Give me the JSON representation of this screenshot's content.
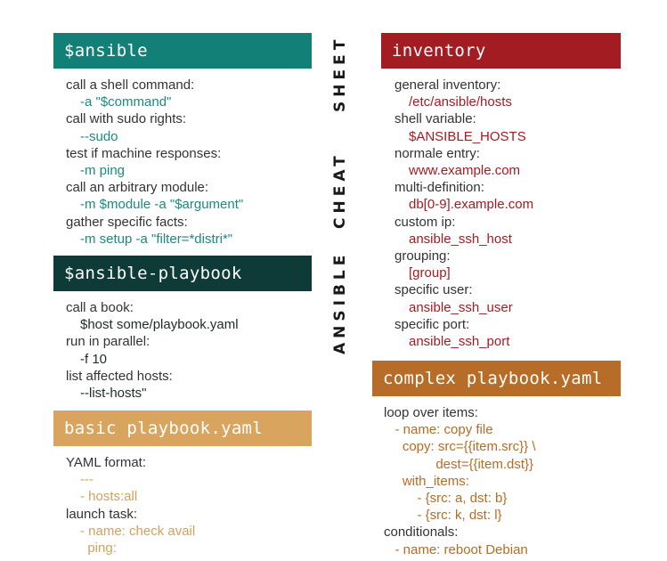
{
  "side_title": {
    "words": [
      "SHEET",
      "CHEAT",
      "ANSIBLE"
    ],
    "full": "ANSIBLE CHEAT SHEET"
  },
  "colors": {
    "ansible_header": "#138077",
    "playbook_header": "#0e3b38",
    "basic_header": "#d9a45e",
    "inventory_header": "#a31c22",
    "complex_header": "#b76c27",
    "teal_text": "#1b8a80",
    "red_text": "#a31c22",
    "tan_text": "#d2a15e",
    "orange_text": "#b56c26"
  },
  "sections": {
    "ansible": {
      "title": "$ansible",
      "items": [
        {
          "label": "call a shell command:",
          "value": "-a \"$command\""
        },
        {
          "label": "call with sudo rights:",
          "value": "--sudo"
        },
        {
          "label": "test if machine responses:",
          "value": "-m ping"
        },
        {
          "label": "call an arbitrary module:",
          "value": "-m $module -a \"$argument\""
        },
        {
          "label": "gather specific facts:",
          "value": "-m setup -a \"filter=*distri*\""
        }
      ]
    },
    "playbook": {
      "title": "$ansible-playbook",
      "items": [
        {
          "label": "call a book:",
          "value": "$host some/playbook.yaml"
        },
        {
          "label": "run in parallel:",
          "value": "-f 10"
        },
        {
          "label": "list affected hosts:",
          "value": "--list-hosts\""
        }
      ]
    },
    "basic": {
      "title": "basic playbook.yaml",
      "lines": [
        {
          "kind": "label",
          "text": "YAML format:"
        },
        {
          "kind": "value",
          "text": "---"
        },
        {
          "kind": "value",
          "text": "- hosts:all"
        },
        {
          "kind": "label",
          "text": "launch task:"
        },
        {
          "kind": "value",
          "text": "- name: check avail"
        },
        {
          "kind": "value",
          "text": "  ping:"
        }
      ]
    },
    "inventory": {
      "title": "inventory",
      "items": [
        {
          "label": "general inventory:",
          "value": "/etc/ansible/hosts"
        },
        {
          "label": "shell variable:",
          "value": "$ANSIBLE_HOSTS"
        },
        {
          "label": "normale entry:",
          "value": "www.example.com"
        },
        {
          "label": "multi-definition:",
          "value": "db[0-9].example.com"
        },
        {
          "label": "custom ip:",
          "value": "ansible_ssh_host"
        },
        {
          "label": "grouping:",
          "value": "[group]"
        },
        {
          "label": "specific user:",
          "value": "ansible_ssh_user"
        },
        {
          "label": "specific port:",
          "value": "ansible_ssh_port"
        }
      ]
    },
    "complex": {
      "title": "complex playbook.yaml",
      "lines": [
        {
          "kind": "label",
          "text": "loop over items:"
        },
        {
          "kind": "value",
          "text": "   - name: copy file"
        },
        {
          "kind": "value",
          "text": "     copy: src={{item.src}} \\"
        },
        {
          "kind": "value",
          "text": "              dest={{item.dst}}"
        },
        {
          "kind": "value",
          "text": "     with_items:"
        },
        {
          "kind": "value",
          "text": "         - {src: a, dst: b}"
        },
        {
          "kind": "value",
          "text": "         - {src: k, dst: l}"
        },
        {
          "kind": "label",
          "text": "conditionals:"
        },
        {
          "kind": "value",
          "text": "   - name: reboot Debian"
        }
      ]
    }
  }
}
